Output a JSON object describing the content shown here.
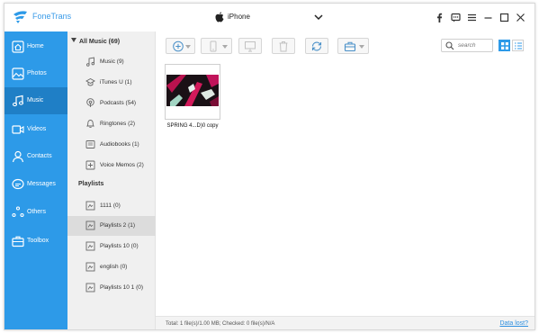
{
  "app": {
    "name": "FoneTrans"
  },
  "device": {
    "name": "iPhone"
  },
  "titlebar_icons": [
    "facebook-icon",
    "feedback-icon",
    "menu-icon",
    "minimize-icon",
    "maximize-icon",
    "close-icon"
  ],
  "nav": {
    "items": [
      {
        "label": "Home",
        "icon": "home-icon",
        "active": false
      },
      {
        "label": "Photos",
        "icon": "photos-icon",
        "active": false
      },
      {
        "label": "Music",
        "icon": "music-icon",
        "active": true
      },
      {
        "label": "Videos",
        "icon": "videos-icon",
        "active": false
      },
      {
        "label": "Contacts",
        "icon": "contacts-icon",
        "active": false
      },
      {
        "label": "Messages",
        "icon": "messages-icon",
        "active": false
      },
      {
        "label": "Others",
        "icon": "others-icon",
        "active": false
      },
      {
        "label": "Toolbox",
        "icon": "toolbox-icon",
        "active": false
      }
    ]
  },
  "categories": {
    "header": "All Music (69)",
    "items": [
      {
        "label": "Music (9)",
        "icon": "music-note-icon"
      },
      {
        "label": "iTunes U (1)",
        "icon": "itunes-u-icon"
      },
      {
        "label": "Podcasts (54)",
        "icon": "podcast-icon"
      },
      {
        "label": "Ringtones (2)",
        "icon": "bell-icon"
      },
      {
        "label": "Audiobooks (1)",
        "icon": "audiobook-icon"
      },
      {
        "label": "Voice Memos (2)",
        "icon": "voice-memo-icon"
      }
    ],
    "playlists_header": "Playlists",
    "playlists": [
      {
        "label": "1111 (0)",
        "active": false
      },
      {
        "label": "Playlists 2 (1)",
        "active": true
      },
      {
        "label": "Playlists 10 (0)",
        "active": false
      },
      {
        "label": "english (0)",
        "active": false
      },
      {
        "label": "Playlists 10 1 (0)",
        "active": false
      }
    ]
  },
  "toolbar": {
    "buttons": [
      "add-icon",
      "phone-export-icon",
      "pc-export-icon",
      "delete-icon",
      "sync-icon",
      "toolbox-icon"
    ],
    "search_placeholder": "search",
    "views": [
      "grid-view-icon",
      "list-view-icon"
    ]
  },
  "files": [
    {
      "name": "SPRING 4...D)0 copy"
    }
  ],
  "status": {
    "text": "Total: 1 file(s)/1.00 MB; Checked: 0 file(s)/N/A",
    "link": "Data lost?"
  },
  "colors": {
    "accent": "#2d9ae8",
    "nav_active": "#1f7fc6",
    "link": "#2d8fe0"
  }
}
